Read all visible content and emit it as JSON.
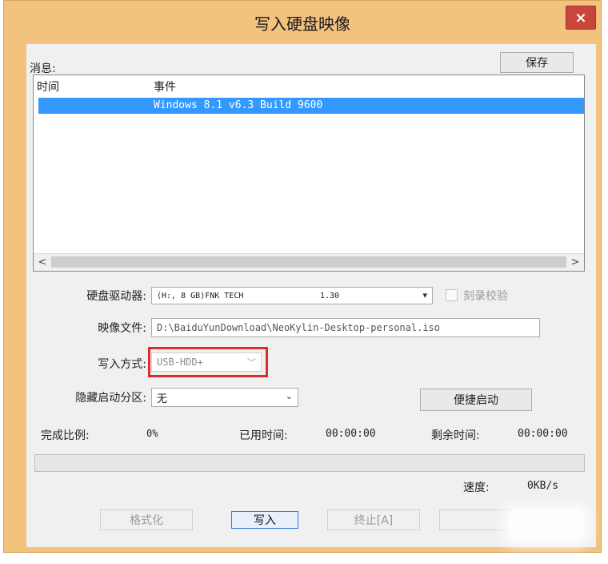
{
  "window": {
    "title": "写入硬盘映像",
    "close_label": "×",
    "accent": "#f2c27f",
    "close_color": "#c9463d"
  },
  "messages": {
    "label": "消息:",
    "save_label": "保存",
    "columns": [
      "时间",
      "事件"
    ],
    "rows": [
      {
        "time": "",
        "event": "Windows 8.1 v6.3 Build 9600"
      }
    ],
    "selected_color": "#3399ff",
    "scroll_left": "<",
    "scroll_right": ">"
  },
  "form": {
    "drive_label": "硬盘驱动器:",
    "drive_value": "(H:, 8 GB)FNK TECH",
    "drive_version": "1.30",
    "verify_label": "刻录校验",
    "image_label": "映像文件:",
    "image_value": "D:\\BaiduYunDownload\\NeoKylin-Desktop-personal.iso",
    "write_mode_label": "写入方式:",
    "write_mode_value": "USB-HDD+",
    "hidden_partition_label": "隐藏启动分区:",
    "hidden_partition_value": "无",
    "quick_boot_label": "便捷启动"
  },
  "status": {
    "progress_label": "完成比例:",
    "progress_value": "0%",
    "elapsed_label": "已用时间:",
    "elapsed_value": "00:00:00",
    "remaining_label": "剩余时间:",
    "remaining_value": "00:00:00",
    "speed_label": "速度:",
    "speed_value": "0KB/s",
    "progress_fraction": 0
  },
  "buttons": {
    "format": "格式化",
    "write": "写入",
    "stop": "终止[A]"
  }
}
